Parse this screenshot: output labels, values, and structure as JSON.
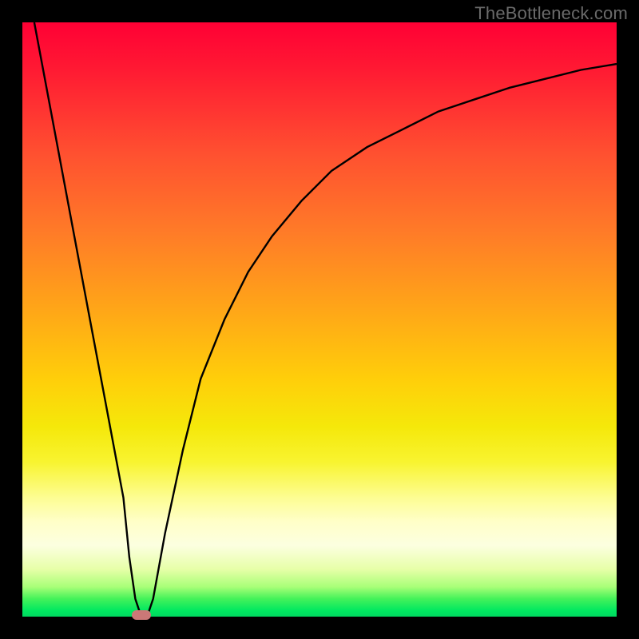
{
  "watermark": "TheBottleneck.com",
  "colors": {
    "frame": "#000000",
    "curve": "#000000",
    "marker": "#cb7877"
  },
  "chart_data": {
    "type": "line",
    "title": "",
    "xlabel": "",
    "ylabel": "",
    "axes_visible": false,
    "xlim": [
      0,
      100
    ],
    "ylim": [
      0,
      100
    ],
    "series": [
      {
        "name": "bottleneck-curve",
        "x": [
          2,
          5,
          8,
          11,
          14,
          17,
          18,
          19,
          20,
          21,
          22,
          24,
          27,
          30,
          34,
          38,
          42,
          47,
          52,
          58,
          64,
          70,
          76,
          82,
          88,
          94,
          100
        ],
        "y": [
          100,
          84,
          68,
          52,
          36,
          20,
          10,
          3,
          0,
          0,
          3,
          14,
          28,
          40,
          50,
          58,
          64,
          70,
          75,
          79,
          82,
          85,
          87,
          89,
          90.5,
          92,
          93
        ]
      }
    ],
    "marker": {
      "x": 20,
      "y": 0,
      "shape": "capsule"
    },
    "note": "Values estimated from pixel positions; axes are unlabeled, 0-100 is a normalized scale."
  }
}
